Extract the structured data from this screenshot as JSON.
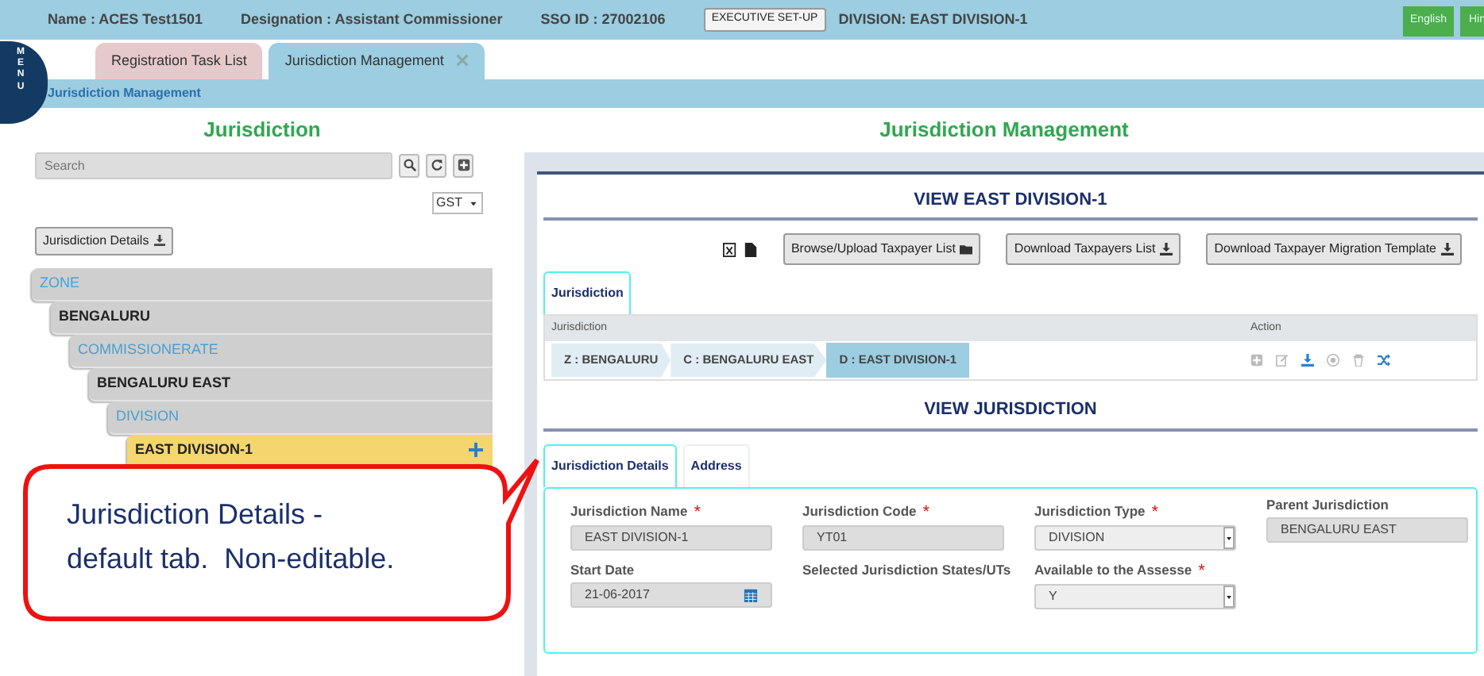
{
  "header": {
    "name": "Name : ACES Test1501",
    "designation": "Designation : Assistant Commissioner",
    "sso_id": "SSO ID : 27002106",
    "setup_button": "EXECUTIVE SET-UP",
    "division": "DIVISION:  EAST DIVISION-1",
    "languages": [
      {
        "label": "English"
      },
      {
        "label": "Hin"
      }
    ]
  },
  "menu_label": "MENU",
  "tabs": [
    {
      "label": "Registration Task List",
      "selected": false,
      "closable": false
    },
    {
      "label": "Jurisdiction Management",
      "selected": true,
      "closable": true
    }
  ],
  "breadcrumb": "Jurisdiction Management",
  "left": {
    "title": "Jurisdiction",
    "search": {
      "placeholder": "Search"
    },
    "filter": "GST",
    "details_button": "Jurisdiction Details",
    "tree": [
      {
        "label": "ZONE",
        "kind": "level",
        "selected": false,
        "children": [
          {
            "label": "BENGALURU",
            "kind": "node",
            "selected": false,
            "children": [
              {
                "label": "COMMISSIONERATE",
                "kind": "level",
                "selected": false,
                "children": [
                  {
                    "label": "BENGALURU EAST",
                    "kind": "node",
                    "selected": false,
                    "children": [
                      {
                        "label": "DIVISION",
                        "kind": "level",
                        "selected": false,
                        "children": [
                          {
                            "label": "EAST DIVISION-1",
                            "kind": "node",
                            "selected": true
                          }
                        ]
                      }
                    ]
                  }
                ]
              }
            ]
          }
        ]
      }
    ]
  },
  "right": {
    "title": "Jurisdiction Management",
    "view_title": "VIEW EAST DIVISION-1",
    "buttons": [
      {
        "label": "Browse/Upload Taxpayer List",
        "kind": "folder"
      },
      {
        "label": "Download Taxpayers List",
        "kind": "download"
      },
      {
        "label": "Download Taxpayer Migration Template",
        "kind": "download"
      }
    ],
    "list_tabs": [
      {
        "label": "Jurisdiction",
        "selected": true
      }
    ],
    "table": {
      "columns": [
        "Jurisdiction",
        "Action"
      ],
      "rows": [
        {
          "path": [
            {
              "label": "Z : BENGALURU",
              "selected": false
            },
            {
              "label": "C : BENGALURU EAST",
              "selected": false
            },
            {
              "label": "D : EAST DIVISION-1",
              "selected": true
            }
          ],
          "actions": [
            {
              "kind": "add",
              "disabled": true
            },
            {
              "kind": "edit",
              "disabled": true
            },
            {
              "kind": "download",
              "disabled": false
            },
            {
              "kind": "view",
              "disabled": true
            },
            {
              "kind": "delete",
              "disabled": true
            },
            {
              "kind": "shuffle",
              "disabled": false
            }
          ]
        }
      ]
    },
    "view_jurisdiction": "VIEW JURISDICTION",
    "detail_tabs": [
      {
        "label": "Jurisdiction Details",
        "selected": true
      },
      {
        "label": "Address",
        "selected": false
      }
    ],
    "fields": [
      {
        "label": "Jurisdiction Name",
        "required_mark": "*",
        "kind": "text",
        "value": "EAST DIVISION-1"
      },
      {
        "label": "Jurisdiction Code",
        "required_mark": "*",
        "kind": "text",
        "value": "YT01"
      },
      {
        "label": "Jurisdiction Type",
        "required_mark": "*",
        "kind": "select",
        "value": "DIVISION"
      },
      {
        "label": "Parent Jurisdiction",
        "kind": "text",
        "value": "BENGALURU EAST"
      },
      {
        "label": "Start Date",
        "kind": "date",
        "value": "21-06-2017"
      },
      {
        "label": "Selected Jurisdiction States/UTs",
        "kind": "none"
      },
      {
        "label": "Available to the Assesse",
        "required_mark": "*",
        "kind": "select",
        "value": "Y"
      }
    ]
  },
  "callout": {
    "lines": [
      "Jurisdiction Details -",
      "default tab.  Non-editable."
    ]
  }
}
